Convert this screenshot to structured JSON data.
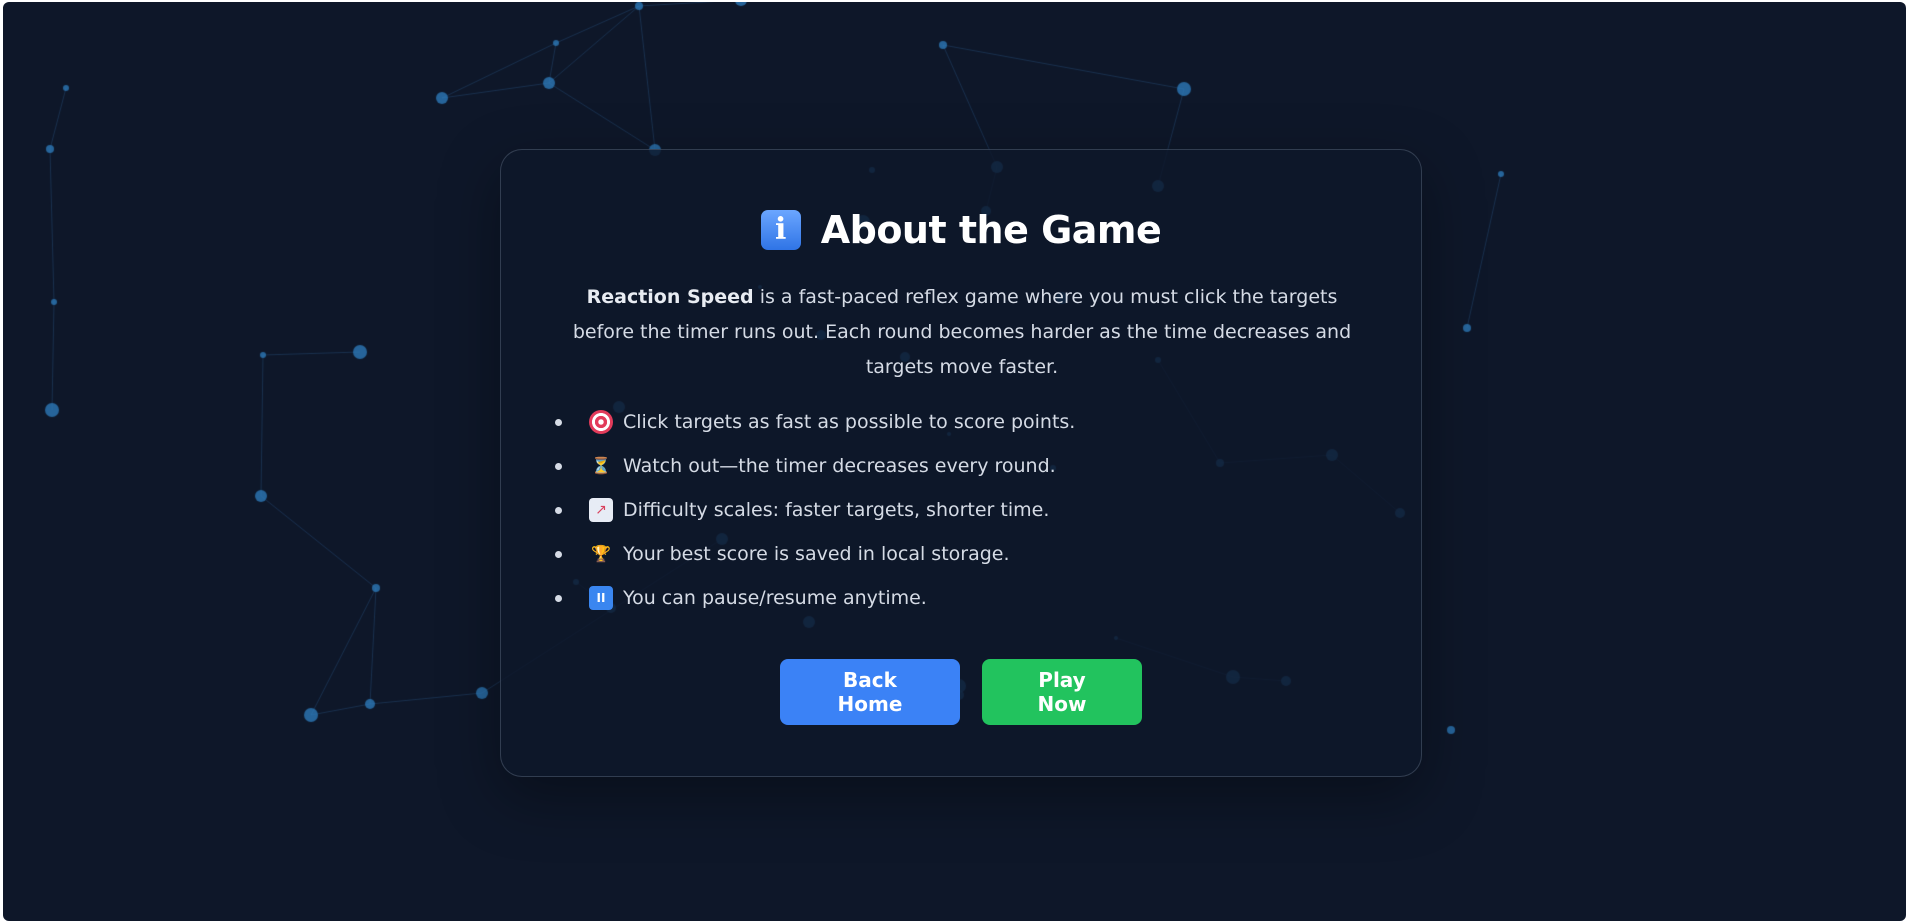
{
  "about": {
    "title_icon": "info-icon",
    "title": "About the Game",
    "description": {
      "game_name": "Reaction Speed",
      "text": " is a fast-paced reflex game where you must click the targets before the timer runs out. Each round becomes harder as the time decreases and targets move faster."
    },
    "features": [
      {
        "icon": "target-icon",
        "glyph": "",
        "text": "Click targets as fast as possible to score points."
      },
      {
        "icon": "hourglass-icon",
        "glyph": "⏳",
        "text": "Watch out—the timer decreases every round."
      },
      {
        "icon": "chart-increasing-icon",
        "glyph": "↗",
        "text": "Difficulty scales: faster targets, shorter time."
      },
      {
        "icon": "trophy-icon",
        "glyph": "🏆",
        "text": "Your best score is saved in local storage."
      },
      {
        "icon": "pause-icon",
        "glyph": "II",
        "text": "You can pause/resume anytime."
      }
    ],
    "buttons": {
      "back_home": "Back Home",
      "play_now": "Play Now"
    }
  },
  "colors": {
    "background": "#0e1729",
    "accent_blue": "#3b82f6",
    "accent_green": "#22c35e",
    "node": "#2f7fc0"
  }
}
